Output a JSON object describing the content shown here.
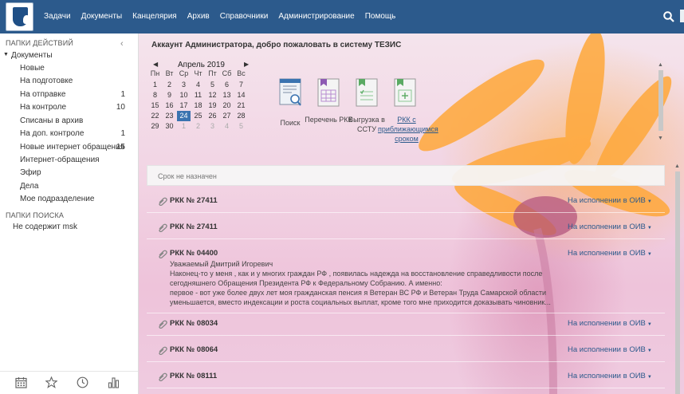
{
  "nav": {
    "items": [
      "Задачи",
      "Документы",
      "Канцелярия",
      "Архив",
      "Справочники",
      "Администрирование",
      "Помощь"
    ]
  },
  "sidebar": {
    "actions_header": "ПАПКИ ДЕЙСТВИЙ",
    "root_label": "Документы",
    "items": [
      {
        "label": "Новые",
        "count": ""
      },
      {
        "label": "На подготовке",
        "count": ""
      },
      {
        "label": "На отправке",
        "count": "1"
      },
      {
        "label": "На контроле",
        "count": "10"
      },
      {
        "label": "Списаны в архив",
        "count": ""
      },
      {
        "label": "На доп. контроле",
        "count": "1"
      },
      {
        "label": "Новые интернет обращения",
        "count": "15"
      },
      {
        "label": "Интернет-обращения",
        "count": ""
      },
      {
        "label": "Эфир",
        "count": ""
      },
      {
        "label": "Дела",
        "count": ""
      },
      {
        "label": "Мое подразделение",
        "count": ""
      }
    ],
    "search_header": "ПАПКИ ПОИСКА",
    "search_items": [
      "Не содержит msk"
    ]
  },
  "welcome": "Аккаунт Администратора, добро пожаловать в систему ТЕЗИС",
  "calendar": {
    "title": "Апрель 2019",
    "weekdays": [
      "Пн",
      "Вт",
      "Ср",
      "Чт",
      "Пт",
      "Сб",
      "Вс"
    ],
    "weeks": [
      [
        "1",
        "2",
        "3",
        "4",
        "5",
        "6",
        "7"
      ],
      [
        "8",
        "9",
        "10",
        "11",
        "12",
        "13",
        "14"
      ],
      [
        "15",
        "16",
        "17",
        "18",
        "19",
        "20",
        "21"
      ],
      [
        "22",
        "23",
        "24",
        "25",
        "26",
        "27",
        "28"
      ],
      [
        "29",
        "30",
        "1",
        "2",
        "3",
        "4",
        "5"
      ]
    ],
    "today": "24"
  },
  "tiles": [
    {
      "label": "Поиск",
      "icon": "search-document-icon"
    },
    {
      "label": "Перечень РКК",
      "icon": "table-list-icon"
    },
    {
      "label": "Выгрузка в ССТУ",
      "icon": "export-document-icon"
    },
    {
      "label": "РКК с приближающимся сроком",
      "icon": "deadline-document-icon"
    }
  ],
  "list": {
    "section_title": "Срок не назначен",
    "tasks": [
      {
        "title": "РКК № 27411",
        "status": "На исполнении в ОИВ",
        "body": []
      },
      {
        "title": "РКК № 27411",
        "status": "На исполнении в ОИВ",
        "body": []
      },
      {
        "title": "РКК № 04400",
        "status": "На исполнении в ОИВ",
        "body": [
          "Уважаемый Дмитрий Игоревич",
          "Наконец-то у меня , как и у многих граждан РФ , появилась надежда на восстановление справедливости после",
          "сегодняшнего Обращения Президента РФ к Федеральному Собранию. А именно:",
          "первое - вот уже более двух лет моя гражданская пенсия я Ветеран ВС РФ и Ветеран Труда Самарской области",
          "уменьшается, вместо индексации и роста социальных выплат, кроме того мне приходится доказывать чиновник..."
        ]
      },
      {
        "title": "РКК № 08034",
        "status": "На исполнении в ОИВ",
        "body": []
      },
      {
        "title": "РКК № 08064",
        "status": "На исполнении в ОИВ",
        "body": []
      },
      {
        "title": "РКК № 08111",
        "status": "На исполнении в ОИВ",
        "body": []
      }
    ]
  },
  "colors": {
    "navbar": "#2c5a8c",
    "accent": "#3a73b0",
    "link": "#2c5a8c"
  }
}
